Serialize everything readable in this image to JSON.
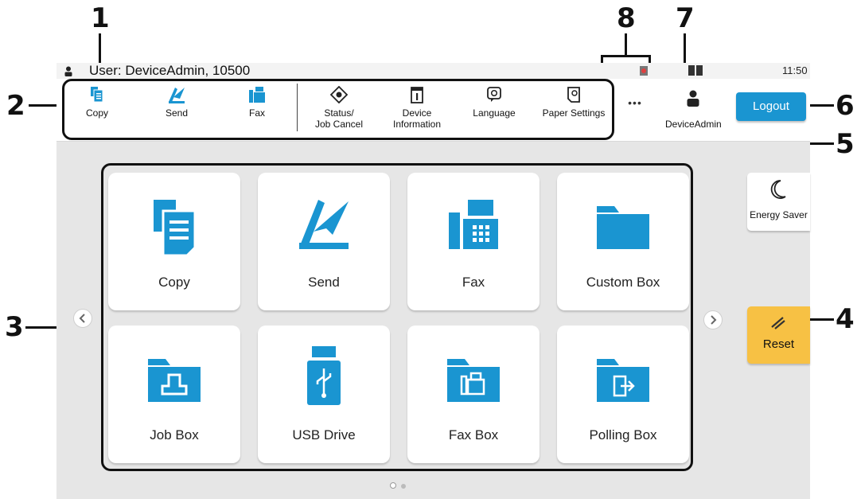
{
  "callouts": [
    "1",
    "2",
    "3",
    "4",
    "5",
    "6",
    "7",
    "8"
  ],
  "status_bar": {
    "user_text": "User:  DeviceAdmin, 10500",
    "time": "11:50"
  },
  "toolbar": {
    "items": [
      {
        "label": "Copy",
        "icon": "copy-icon"
      },
      {
        "label": "Send",
        "icon": "send-icon"
      },
      {
        "label": "Fax",
        "icon": "fax-icon"
      },
      {
        "label": "Status/\nJob Cancel",
        "icon": "status-icon"
      },
      {
        "label": "Device\nInformation",
        "icon": "device-info-icon"
      },
      {
        "label": "Language",
        "icon": "language-icon"
      },
      {
        "label": "Paper Settings",
        "icon": "paper-settings-icon"
      }
    ],
    "more": "•••",
    "account_label": "DeviceAdmin",
    "logout_label": "Logout"
  },
  "tiles": [
    {
      "label": "Copy",
      "icon": "copy-icon"
    },
    {
      "label": "Send",
      "icon": "send-icon"
    },
    {
      "label": "Fax",
      "icon": "fax-icon"
    },
    {
      "label": "Custom Box",
      "icon": "folder-icon"
    },
    {
      "label": "Job Box",
      "icon": "job-box-icon"
    },
    {
      "label": "USB Drive",
      "icon": "usb-drive-icon"
    },
    {
      "label": "Fax Box",
      "icon": "fax-box-icon"
    },
    {
      "label": "Polling Box",
      "icon": "polling-box-icon"
    }
  ],
  "side": {
    "energy_saver_label": "Energy Saver",
    "reset_label": "Reset"
  },
  "pagination": {
    "pages": 2,
    "current": 1
  },
  "colors": {
    "accent": "#1a95d1",
    "reset": "#f7c144",
    "callout_outline": "#111111"
  }
}
